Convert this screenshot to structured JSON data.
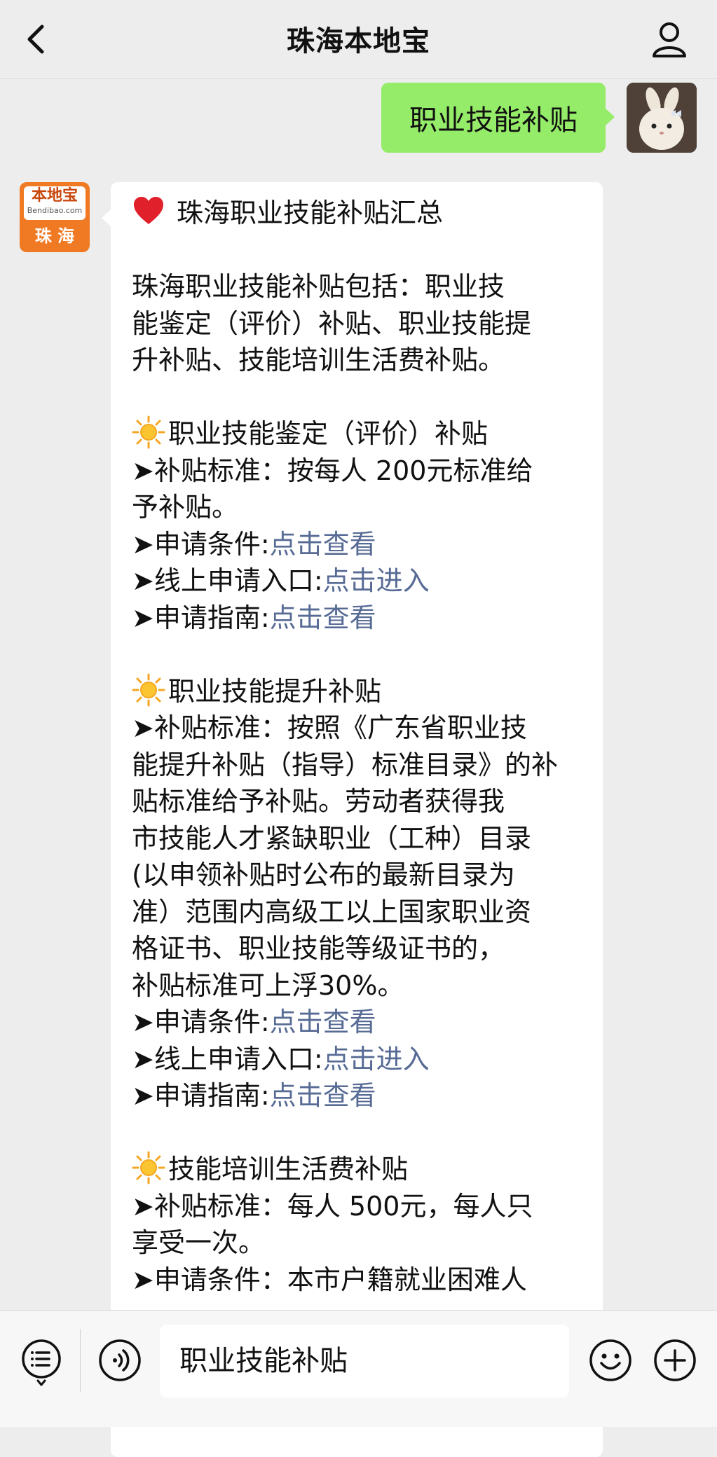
{
  "header": {
    "title": "珠海本地宝",
    "back_icon": "chevron-left-icon",
    "profile_icon": "person-icon"
  },
  "outgoing_message": {
    "text": "职业技能补贴",
    "bubble_color": "#95ec69"
  },
  "bot": {
    "logo_text": "本地宝",
    "logo_domain": "Bendibao.com",
    "logo_city": "珠 海",
    "brand_color": "#f07a23"
  },
  "reply": {
    "title": "珠海职业技能补贴汇总",
    "intro": [
      "珠海职业技能补贴包括：职业技",
      "能鉴定（评价）补贴、职业技能提",
      "升补贴、技能培训生活费补贴。"
    ],
    "section1": {
      "heading": "职业技能鉴定（评价）补贴",
      "standard": [
        "➤补贴标准：按每人 200元标准给",
        "予补贴。"
      ],
      "conditions_label": "➤申请条件:",
      "conditions_link": "点击查看",
      "online_label": "➤线上申请入口:",
      "online_link": "点击进入",
      "guide_label": "➤申请指南:",
      "guide_link": "点击查看"
    },
    "section2": {
      "heading": "职业技能提升补贴",
      "standard": [
        "➤补贴标准：按照《广东省职业技",
        "能提升补贴（指导）标准目录》的补",
        "贴标准给予补贴。劳动者获得我",
        "市技能人才紧缺职业（工种）目录",
        "(以申领补贴时公布的最新目录为",
        "准）范围内高级工以上国家职业资",
        "格证书、职业技能等级证书的，",
        "补贴标准可上浮30%。"
      ],
      "conditions_label": "➤申请条件:",
      "conditions_link": "点击查看",
      "online_label": "➤线上申请入口:",
      "online_link": "点击进入",
      "guide_label": "➤申请指南:",
      "guide_link": "点击查看"
    },
    "section3": {
      "heading": "技能培训生活费补贴",
      "standard": [
        "➤补贴标准：每人 500元，每人只",
        "享受一次。"
      ],
      "conditions": [
        "➤申请条件：本市户籍就业困难人"
      ]
    },
    "link_color": "#576b95"
  },
  "input_bar": {
    "text": "职业技能补贴",
    "menu_icon": "menu-list-icon",
    "voice_icon": "voice-icon",
    "emoji_icon": "emoji-icon",
    "plus_icon": "plus-icon"
  }
}
